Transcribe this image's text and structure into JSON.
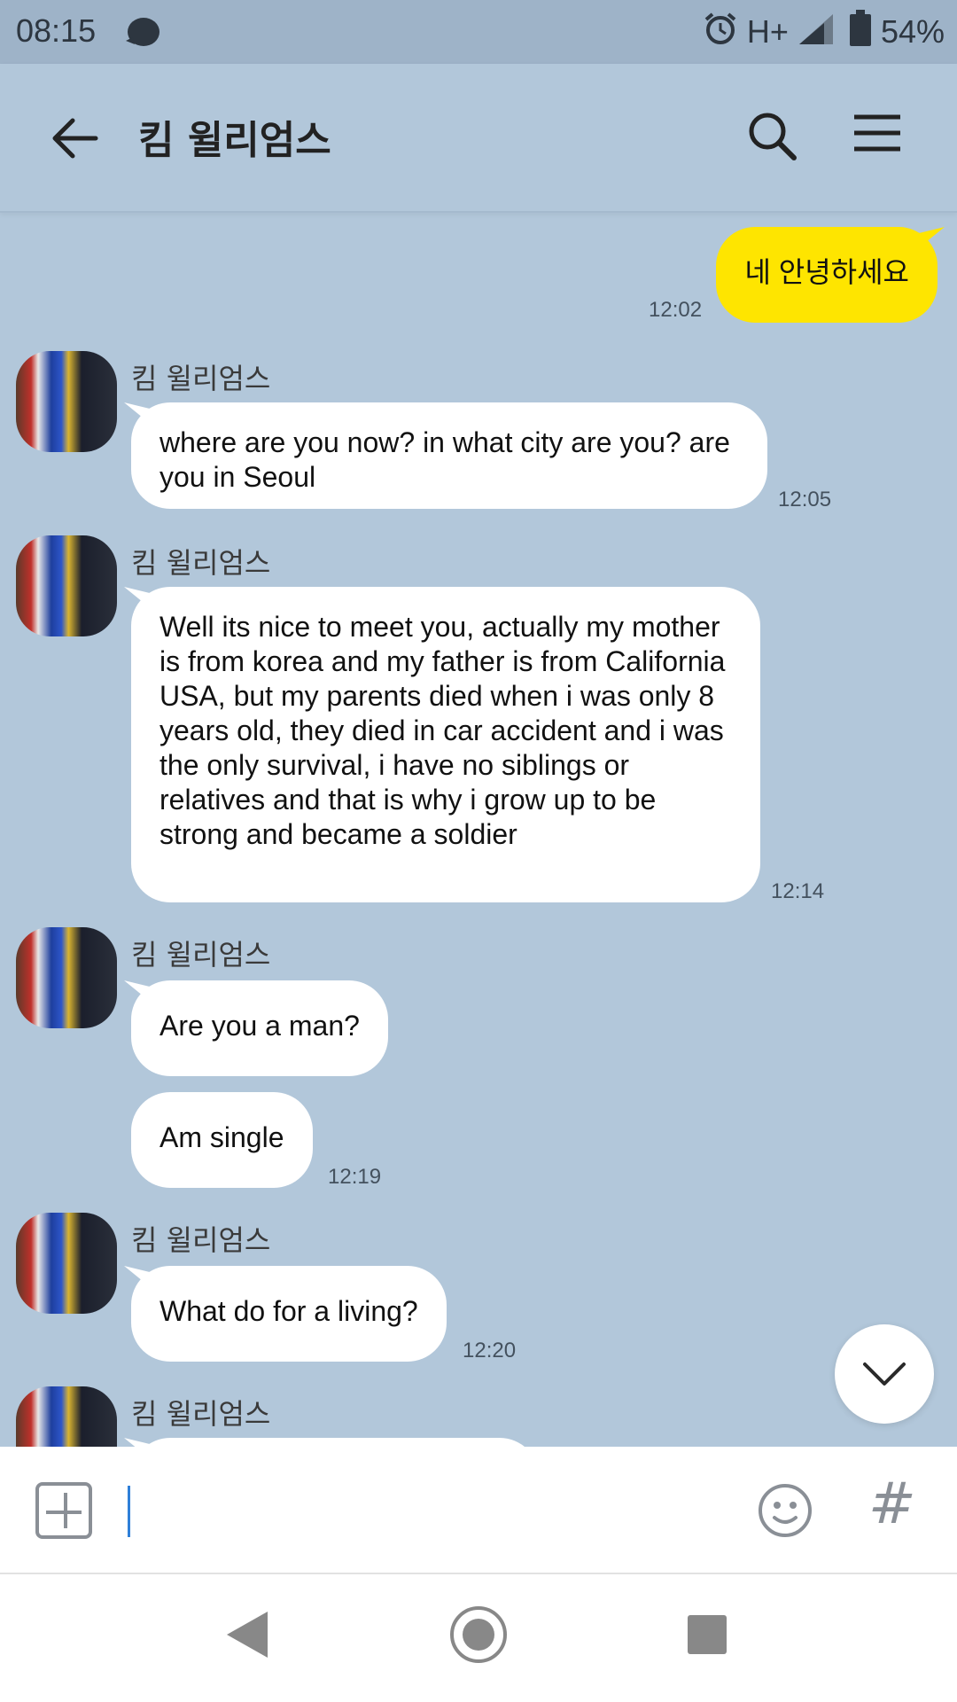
{
  "status_bar": {
    "time": "08:15",
    "network": "H+",
    "battery": "54%",
    "icons": [
      "chat-notification-icon",
      "alarm-icon",
      "signal-icon",
      "battery-icon"
    ]
  },
  "header": {
    "title": "킴 윌리엄스",
    "back_icon": "arrow-left-icon",
    "search_icon": "search-icon",
    "menu_icon": "hamburger-menu-icon"
  },
  "messages": [
    {
      "from": "me",
      "text": "네 안녕하세요",
      "time": "12:02"
    },
    {
      "from": "킴 윌리엄스",
      "text": "where are you now? in what city are you? are you in Seoul",
      "time": "12:05"
    },
    {
      "from": "킴 윌리엄스",
      "text": "Well its nice to meet you, actually my mother is from korea and my father is from California USA, but my parents died when i was only 8 years old, they died in car accident and i was the only survival, i have no siblings or relatives and that is why i grow up to be strong and became a soldier",
      "time": "12:14"
    },
    {
      "from": "킴 윌리엄스",
      "text": "Are you a man?",
      "time": ""
    },
    {
      "from": "킴 윌리엄스",
      "text": "Am single",
      "time": "12:19"
    },
    {
      "from": "킴 윌리엄스",
      "text": "What do for a living?",
      "time": "12:20"
    },
    {
      "from": "킴 윌리엄스",
      "text": "",
      "time": ""
    }
  ],
  "input": {
    "placeholder": "",
    "value": ""
  },
  "colors": {
    "chat_background": "#b2c7da",
    "my_bubble": "#fee500",
    "their_bubble": "#ffffff"
  }
}
